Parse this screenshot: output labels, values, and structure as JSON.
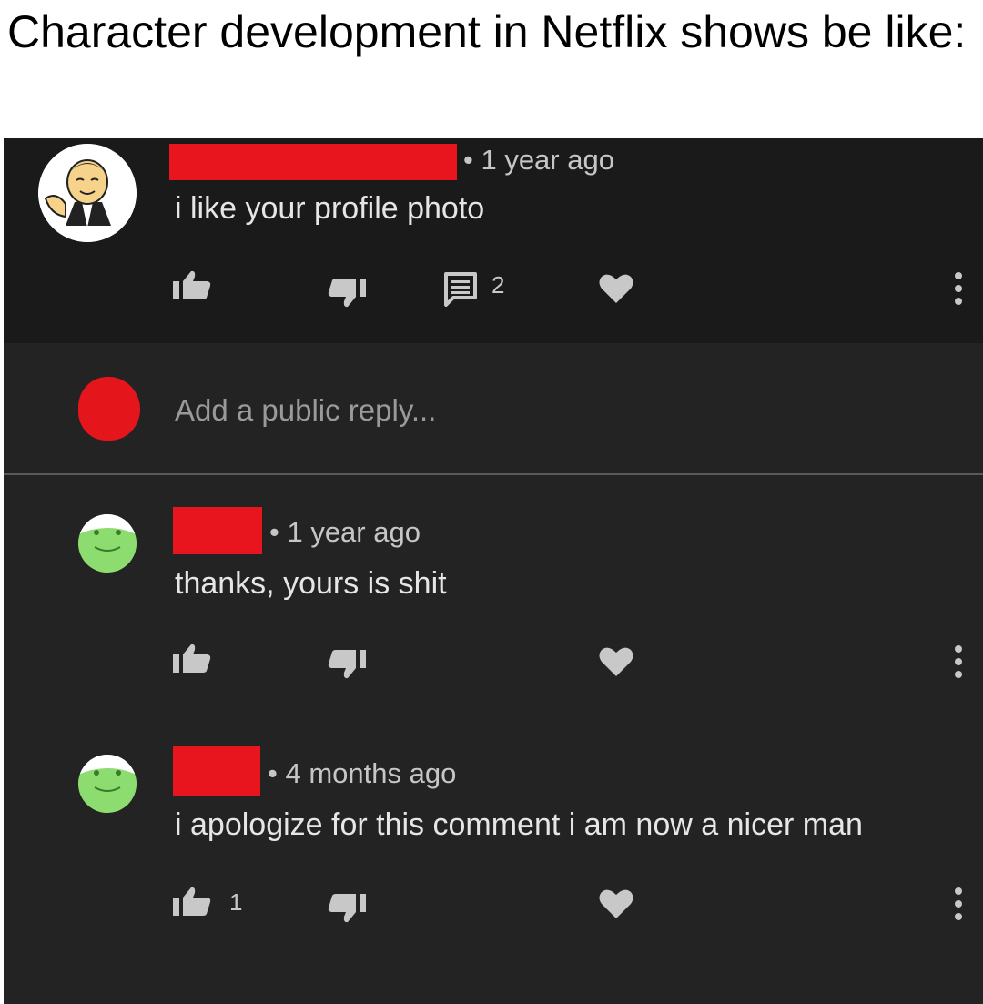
{
  "caption": "Character development in Netflix shows be like:",
  "colors": {
    "background": "#232323",
    "top_comment_bg": "#1a1a1a",
    "redaction": "#e8151e",
    "icon": "#c8c8c8"
  },
  "comment": {
    "time": "• 1 year ago",
    "text": "i like your profile photo",
    "reply_count": "2",
    "icons": [
      "thumbs-up-icon",
      "thumbs-down-icon",
      "reply-icon",
      "heart-icon",
      "more-icon"
    ]
  },
  "reply_input": {
    "placeholder": "Add a public reply..."
  },
  "replies": [
    {
      "time": "• 1 year ago",
      "text": "thanks, yours is shit",
      "like_count": ""
    },
    {
      "time": "• 4 months ago",
      "text": "i apologize for this comment i am now a nicer man",
      "like_count": "1"
    }
  ]
}
